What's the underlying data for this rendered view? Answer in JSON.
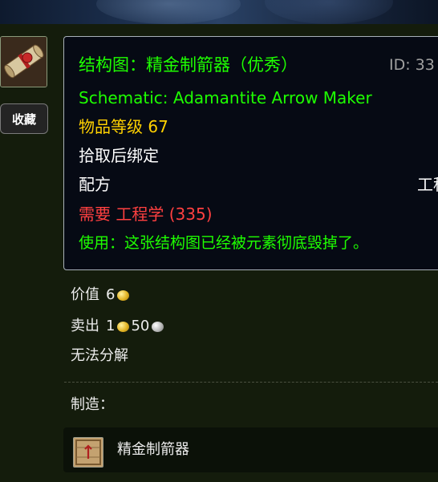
{
  "item": {
    "icon": "scroll-schematic-icon",
    "favorite_label": "收藏"
  },
  "tooltip": {
    "title_cn": "结构图：精金制箭器（优秀）",
    "id_text": "ID: 33",
    "name_en": "Schematic: Adamantite Arrow Maker",
    "item_level": "物品等级 67",
    "binding": "拾取后绑定",
    "type_label": "配方",
    "type_right": "工程",
    "requirement": "需要 工程学 (335)",
    "use_text": "使用：这张结构图已经被元素彻底毁掉了。"
  },
  "info": {
    "price_label": "价值",
    "price_gold": "6",
    "sell_label": "卖出",
    "sell_gold": "1",
    "sell_silver": "50",
    "disenchant_text": "无法分解"
  },
  "crafting": {
    "label": "制造：",
    "items": [
      {
        "name": "精金制箭器",
        "icon": "wooden-crate-icon"
      }
    ]
  },
  "colors": {
    "uncommon_green": "#1eff00",
    "item_level_gold": "#ffd100",
    "requirement_red": "#ff4040",
    "background": "#141c0c",
    "tooltip_bg": "#060a14"
  }
}
